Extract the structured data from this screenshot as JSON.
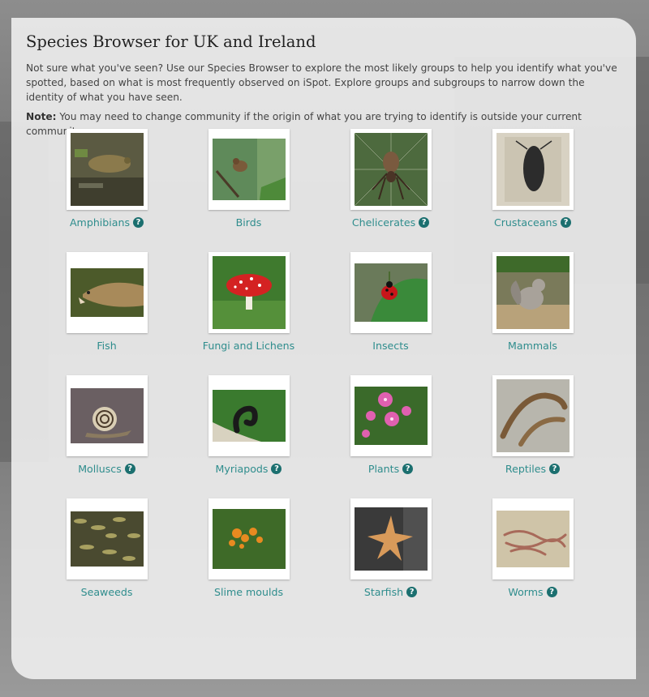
{
  "page": {
    "title": "Species Browser for UK and Ireland",
    "intro": "Not sure what you've seen? Use our Species Browser to explore the most likely groups to help you identify what you've spotted, based on what is most frequently observed on iSpot. Explore groups and subgroups to narrow down the identity of what you have seen.",
    "note_label": "Note:",
    "note_text": " You may need to change community if the origin of what you are trying to identify is outside your current community.",
    "help_glyph": "?"
  },
  "groups": [
    {
      "label": "Amphibians",
      "has_help": true
    },
    {
      "label": "Birds",
      "has_help": false
    },
    {
      "label": "Chelicerates",
      "has_help": true
    },
    {
      "label": "Crustaceans",
      "has_help": true
    },
    {
      "label": "Fish",
      "has_help": false
    },
    {
      "label": "Fungi and Lichens",
      "has_help": false
    },
    {
      "label": "Insects",
      "has_help": false
    },
    {
      "label": "Mammals",
      "has_help": false
    },
    {
      "label": "Molluscs",
      "has_help": true
    },
    {
      "label": "Myriapods",
      "has_help": true
    },
    {
      "label": "Plants",
      "has_help": true
    },
    {
      "label": "Reptiles",
      "has_help": true
    },
    {
      "label": "Seaweeds",
      "has_help": false
    },
    {
      "label": "Slime moulds",
      "has_help": false
    },
    {
      "label": "Starfish",
      "has_help": true
    },
    {
      "label": "Worms",
      "has_help": true
    }
  ],
  "colors": {
    "link": "#2f8d8d",
    "help_badge": "#1b6f6f"
  }
}
